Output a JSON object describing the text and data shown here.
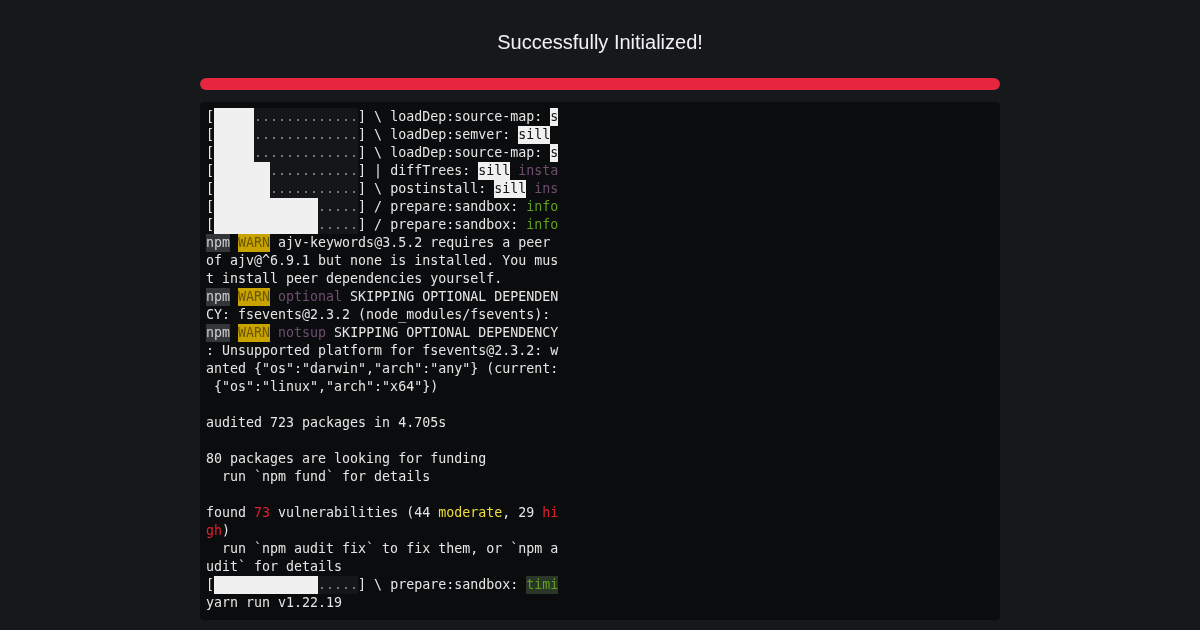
{
  "title": "Successfully Initialized!",
  "progress": {
    "level": 1
  },
  "terminal": {
    "lines": [
      {
        "kind": "progress",
        "open": "[",
        "level": 0.28,
        "dots": ".............",
        "rest": [
          {
            "text": "] \\ loadDep:source-map:",
            "kind": "plain"
          },
          {
            "text": "s",
            "kind": "inverse"
          }
        ]
      },
      {
        "kind": "progress",
        "open": "[",
        "level": 0.28,
        "dots": ".............",
        "rest": [
          {
            "text": "] \\ loadDep:semver:",
            "kind": "plain"
          },
          {
            "text": "sill",
            "kind": "inverse"
          }
        ]
      },
      {
        "kind": "progress",
        "open": "[",
        "level": 0.28,
        "dots": ".............",
        "rest": [
          {
            "text": "] \\ loadDep:source-map:",
            "kind": "plain"
          },
          {
            "text": "s",
            "kind": "inverse"
          }
        ]
      },
      {
        "kind": "progress",
        "open": "[",
        "level": 0.39,
        "dots": "...........",
        "rest": [
          {
            "text": "] | diffTrees:",
            "kind": "plain"
          },
          {
            "text": "sill",
            "kind": "inverse"
          },
          {
            "text": "insta",
            "kind": "dim"
          }
        ]
      },
      {
        "kind": "progress",
        "open": "[",
        "level": 0.39,
        "dots": "...........",
        "rest": [
          {
            "text": "] \\ postinstall:",
            "kind": "plain"
          },
          {
            "text": "sill",
            "kind": "inverse"
          },
          {
            "text": "ins",
            "kind": "dim"
          }
        ]
      },
      {
        "kind": "progress",
        "open": "[",
        "level": 0.72,
        "dots": ".....",
        "rest": [
          {
            "text": "] / prepare:sandbox:",
            "kind": "plain"
          },
          {
            "text": "info",
            "kind": "green"
          }
        ]
      },
      {
        "kind": "progress",
        "open": "[",
        "level": 0.72,
        "dots": ".....",
        "rest": [
          {
            "text": "] / prepare:sandbox:",
            "kind": "plain"
          },
          {
            "text": "info",
            "kind": "green"
          }
        ]
      },
      {
        "kind": "text",
        "segments": [
          {
            "text": "npm",
            "kind": "npm"
          },
          {
            "text": "WARN",
            "kind": "warn"
          },
          {
            "text": "ajv-keywords@3.5.2 requires a peer",
            "kind": "plain"
          }
        ]
      },
      {
        "kind": "text",
        "segments": [
          {
            "text": "of ajv@^6.9.1 but none is installed. You mus",
            "kind": "plain"
          }
        ]
      },
      {
        "kind": "text",
        "segments": [
          {
            "text": "t install peer dependencies yourself.",
            "kind": "plain"
          }
        ]
      },
      {
        "kind": "text",
        "segments": [
          {
            "text": "npm",
            "kind": "npm"
          },
          {
            "text": "WARN",
            "kind": "warn"
          },
          {
            "text": "optional",
            "kind": "dim"
          },
          {
            "text": " SKIPPING OPTIONAL DEPENDEN",
            "kind": "plain"
          }
        ]
      },
      {
        "kind": "text",
        "segments": [
          {
            "text": "CY: fsevents@2.3.2 (node_modules/fsevents):",
            "kind": "plain"
          }
        ]
      },
      {
        "kind": "text",
        "segments": [
          {
            "text": "npm",
            "kind": "npm"
          },
          {
            "text": "WARN",
            "kind": "warn"
          },
          {
            "text": "notsup",
            "kind": "dim"
          },
          {
            "text": " SKIPPING OPTIONAL DEPENDENCY",
            "kind": "plain"
          }
        ]
      },
      {
        "kind": "text",
        "segments": [
          {
            "text": ": Unsupported platform for fsevents@2.3.2: w",
            "kind": "plain"
          }
        ]
      },
      {
        "kind": "text",
        "segments": [
          {
            "text": "anted {\"os\":\"darwin\",\"arch\":\"any\"} (current:",
            "kind": "plain"
          }
        ]
      },
      {
        "kind": "text",
        "segments": [
          {
            "text": " {\"os\":\"linux\",\"arch\":\"x64\"})",
            "kind": "plain"
          }
        ]
      },
      {
        "kind": "blank"
      },
      {
        "kind": "text",
        "segments": [
          {
            "text": "audited 723 packages in 4.705s",
            "kind": "plain"
          }
        ]
      },
      {
        "kind": "blank"
      },
      {
        "kind": "text",
        "segments": [
          {
            "text": "80 packages are looking for funding",
            "kind": "plain"
          }
        ]
      },
      {
        "kind": "text",
        "segments": [
          {
            "text": "  run `npm fund` for details",
            "kind": "plain"
          }
        ]
      },
      {
        "kind": "blank"
      },
      {
        "kind": "text",
        "segments": [
          {
            "text": "found ",
            "kind": "plain"
          },
          {
            "text": "73",
            "kind": "red"
          },
          {
            "text": " vulnerabilities (44 ",
            "kind": "plain"
          },
          {
            "text": "moderate",
            "kind": "yellow"
          },
          {
            "text": ", 29 ",
            "kind": "plain"
          },
          {
            "text": "hi",
            "kind": "red"
          }
        ]
      },
      {
        "kind": "text",
        "segments": [
          {
            "text": "gh",
            "kind": "red"
          },
          {
            "text": ")",
            "kind": "plain"
          }
        ]
      },
      {
        "kind": "text",
        "segments": [
          {
            "text": "  run `npm audit fix` to fix them, or `npm a",
            "kind": "plain"
          }
        ]
      },
      {
        "kind": "text",
        "segments": [
          {
            "text": "udit` for details",
            "kind": "plain"
          }
        ]
      },
      {
        "kind": "progress",
        "open": "[",
        "level": 0.72,
        "dots": ".....",
        "rest": [
          {
            "text": "] \\ prepare:sandbox:",
            "kind": "plain"
          },
          {
            "text": "timi",
            "kind": "greenbg"
          }
        ]
      },
      {
        "kind": "text",
        "segments": [
          {
            "text": "yarn run v1.22.19",
            "kind": "plain"
          }
        ]
      }
    ]
  }
}
